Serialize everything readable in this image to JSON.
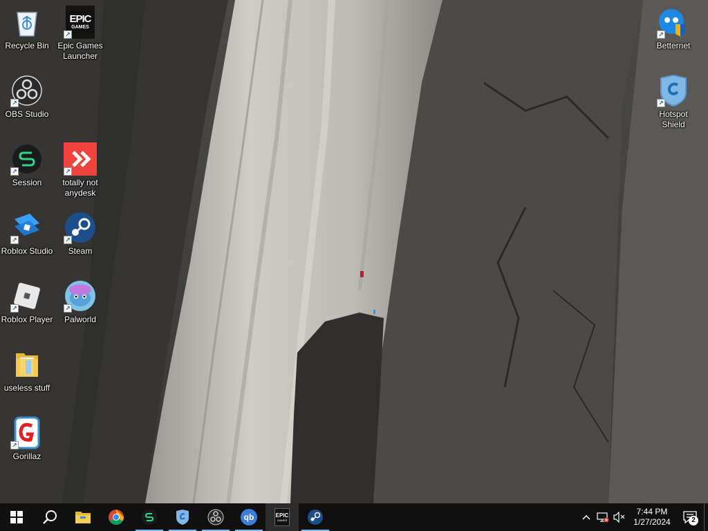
{
  "desktop": {
    "icons": [
      {
        "label": "Recycle Bin",
        "icon": "recycle-bin-icon"
      },
      {
        "label": "Epic Games Launcher",
        "icon": "epic-games-icon"
      },
      {
        "label": "OBS Studio",
        "icon": "obs-icon"
      },
      {
        "label": "Session",
        "icon": "session-icon"
      },
      {
        "label": "totally not anydesk",
        "icon": "anydesk-icon"
      },
      {
        "label": "Roblox Studio",
        "icon": "roblox-studio-icon"
      },
      {
        "label": "Steam",
        "icon": "steam-icon"
      },
      {
        "label": "Roblox Player",
        "icon": "roblox-player-icon"
      },
      {
        "label": "Palworld",
        "icon": "palworld-icon"
      },
      {
        "label": "useless stuff",
        "icon": "folder-icon"
      },
      {
        "label": "Gorillaz",
        "icon": "gorillaz-icon"
      },
      {
        "label": "Betternet",
        "icon": "betternet-icon"
      },
      {
        "label": "Hotspot Shield",
        "icon": "hotspot-shield-icon"
      }
    ],
    "epic_logo_text": "EPIC\nGAMES",
    "epic_logo_top": "EPIC",
    "epic_logo_bottom": "GAMES"
  },
  "taskbar": {
    "pinned": [
      {
        "name": "start-button",
        "icon": "windows-logo-icon"
      },
      {
        "name": "search-button",
        "icon": "search-icon"
      },
      {
        "name": "file-explorer",
        "icon": "folder-icon"
      },
      {
        "name": "chrome",
        "icon": "chrome-icon"
      },
      {
        "name": "session",
        "icon": "session-icon"
      },
      {
        "name": "hotspot-shield",
        "icon": "hotspot-shield-icon"
      },
      {
        "name": "obs",
        "icon": "obs-icon"
      },
      {
        "name": "qbittorrent",
        "icon": "qbittorrent-icon"
      },
      {
        "name": "epic-games",
        "icon": "epic-games-icon"
      },
      {
        "name": "steam",
        "icon": "steam-icon"
      }
    ],
    "qb_text": "qb",
    "epic_text_top": "EPIC",
    "epic_text_bottom": "GAMES",
    "clock": {
      "time": "7:44 PM",
      "date": "1/27/2024"
    },
    "notification_count": "2"
  }
}
